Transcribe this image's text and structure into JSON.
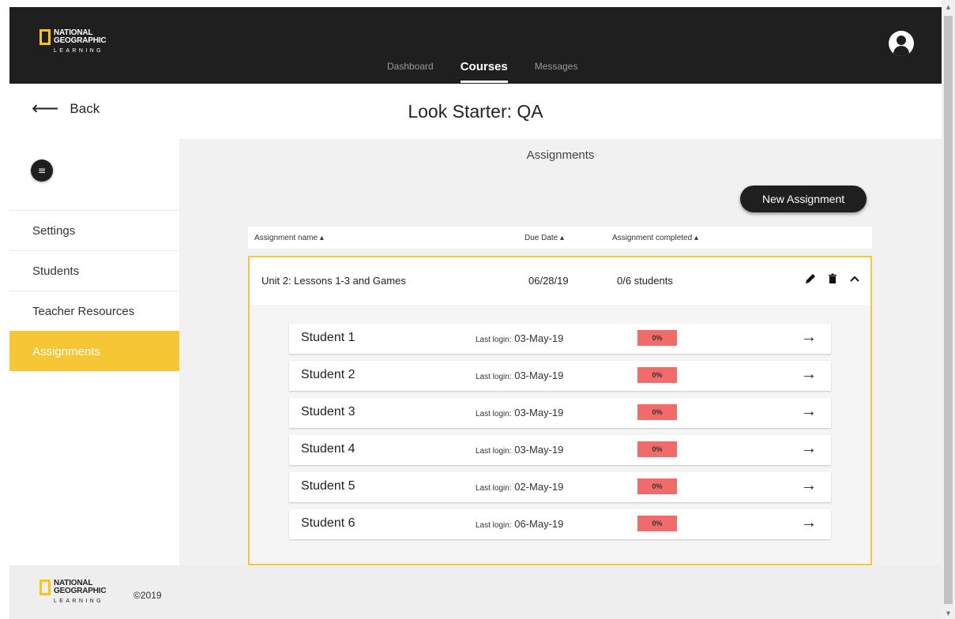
{
  "brand": {
    "line1": "NATIONAL",
    "line2": "GEOGRAPHIC",
    "line3": "LEARNING"
  },
  "nav": {
    "items": [
      "Dashboard",
      "Courses",
      "Messages"
    ],
    "active": "Courses"
  },
  "header": {
    "back_label": "Back",
    "title": "Look Starter: QA"
  },
  "sidebar": {
    "menu_icon": "menu-icon",
    "items": [
      {
        "label": "Settings",
        "active": false
      },
      {
        "label": "Students",
        "active": false
      },
      {
        "label": "Teacher Resources",
        "active": false
      },
      {
        "label": "Assignments",
        "active": true
      }
    ]
  },
  "main": {
    "section_title": "Assignments",
    "new_button": "New Assignment",
    "columns": [
      "Assignment name ▴",
      "Due Date ▴",
      "Assignment completed ▴"
    ],
    "assignment": {
      "name": "Unit 2: Lessons 1-3 and Games",
      "due": "06/28/19",
      "completed": "0/6 students"
    },
    "last_login_label": "Last login:",
    "students": [
      {
        "name": "Student 1",
        "last_login": "03-May-19",
        "progress": "0%"
      },
      {
        "name": "Student 2",
        "last_login": "03-May-19",
        "progress": "0%"
      },
      {
        "name": "Student 3",
        "last_login": "03-May-19",
        "progress": "0%"
      },
      {
        "name": "Student 4",
        "last_login": "03-May-19",
        "progress": "0%"
      },
      {
        "name": "Student 5",
        "last_login": "02-May-19",
        "progress": "0%"
      },
      {
        "name": "Student 6",
        "last_login": "06-May-19",
        "progress": "0%"
      }
    ]
  },
  "footer": {
    "copyright": "©2019"
  },
  "colors": {
    "accent": "#f7c634",
    "topbar": "#1f1f1f",
    "progress_bad": "#f26b6b"
  }
}
